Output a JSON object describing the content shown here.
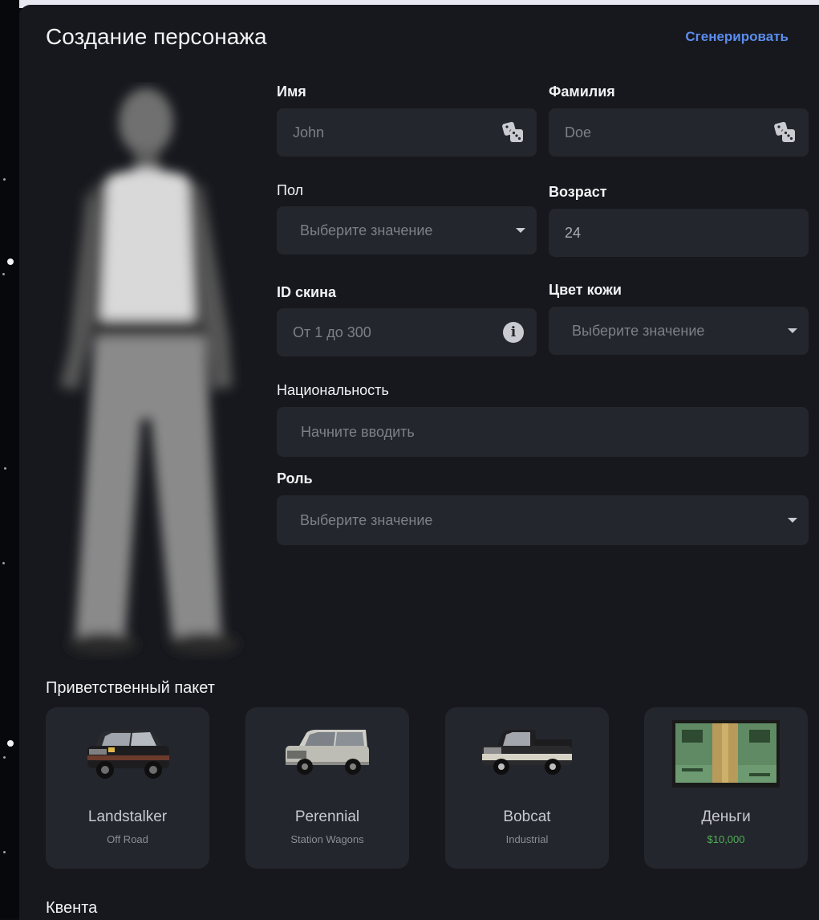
{
  "header": {
    "title": "Создание персонажа",
    "generate_label": "Сгенерировать"
  },
  "form": {
    "first_name": {
      "label": "Имя",
      "placeholder": "John"
    },
    "last_name": {
      "label": "Фамилия",
      "placeholder": "Doe"
    },
    "gender": {
      "label": "Пол",
      "placeholder": "Выберите значение"
    },
    "age": {
      "label": "Возраст",
      "value": "24"
    },
    "skin_id": {
      "label": "ID скина",
      "placeholder": "От 1 до 300"
    },
    "skin_color": {
      "label": "Цвет кожи",
      "placeholder": "Выберите значение"
    },
    "nationality": {
      "label": "Национальность",
      "placeholder": "Начните вводить"
    },
    "role": {
      "label": "Роль",
      "placeholder": "Выберите значение"
    }
  },
  "welcome_pack": {
    "title": "Приветственный пакет",
    "items": [
      {
        "name": "Landstalker",
        "sub": "Off Road",
        "icon": "suv-car-icon"
      },
      {
        "name": "Perennial",
        "sub": "Station Wagons",
        "icon": "wagon-car-icon"
      },
      {
        "name": "Bobcat",
        "sub": "Industrial",
        "icon": "pickup-truck-icon"
      },
      {
        "name": "Деньги",
        "sub": "$10,000",
        "icon": "money-stack-icon"
      }
    ]
  },
  "next_section": {
    "title": "Квента"
  },
  "colors": {
    "panel": "#17181d",
    "field": "#24262d",
    "accent": "#5b8dee",
    "money": "#4fae56"
  }
}
